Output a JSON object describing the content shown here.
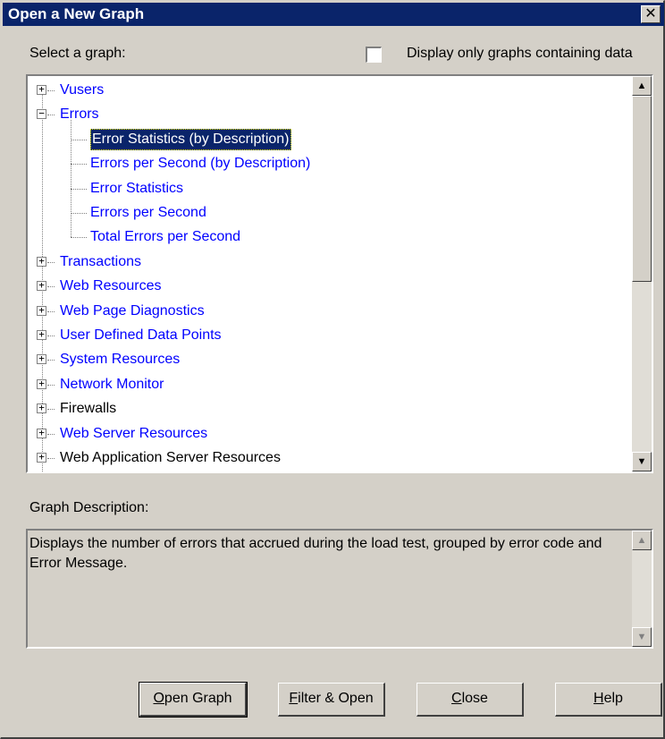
{
  "window": {
    "title": "Open a New Graph",
    "close_glyph": "✕"
  },
  "select_label": "Select a graph:",
  "filter_checkbox": {
    "label": "Display only graphs containing data",
    "checked": false
  },
  "tree": {
    "items": [
      {
        "label": "Vusers",
        "expander": "+",
        "level": 0,
        "color": "blue"
      },
      {
        "label": "Errors",
        "expander": "−",
        "level": 0,
        "color": "blue"
      },
      {
        "label": "Error Statistics (by Description)",
        "level": 1,
        "color": "blue",
        "selected": true
      },
      {
        "label": "Errors per Second (by Description)",
        "level": 1,
        "color": "blue"
      },
      {
        "label": "Error Statistics",
        "level": 1,
        "color": "blue"
      },
      {
        "label": "Errors per Second",
        "level": 1,
        "color": "blue"
      },
      {
        "label": "Total Errors per Second",
        "level": 1,
        "color": "blue"
      },
      {
        "label": "Transactions",
        "expander": "+",
        "level": 0,
        "color": "blue"
      },
      {
        "label": "Web Resources",
        "expander": "+",
        "level": 0,
        "color": "blue"
      },
      {
        "label": "Web Page Diagnostics",
        "expander": "+",
        "level": 0,
        "color": "blue"
      },
      {
        "label": "User Defined Data Points",
        "expander": "+",
        "level": 0,
        "color": "blue"
      },
      {
        "label": "System Resources",
        "expander": "+",
        "level": 0,
        "color": "blue"
      },
      {
        "label": "Network Monitor",
        "expander": "+",
        "level": 0,
        "color": "blue"
      },
      {
        "label": "Firewalls",
        "expander": "+",
        "level": 0,
        "color": "black"
      },
      {
        "label": "Web Server Resources",
        "expander": "+",
        "level": 0,
        "color": "blue"
      },
      {
        "label": "Web Application Server Resources",
        "expander": "+",
        "level": 0,
        "color": "black"
      }
    ],
    "scroll_up": "▲",
    "scroll_down": "▼"
  },
  "description": {
    "label": "Graph Description:",
    "text": "Displays the number of errors that accrued during the load test, grouped by error code and Error Message."
  },
  "buttons": {
    "open_graph": {
      "prefix": "",
      "underline": "O",
      "rest": "pen Graph"
    },
    "filter_open": {
      "prefix": "",
      "underline": "F",
      "rest": "ilter & Open"
    },
    "close": {
      "prefix": "",
      "underline": "C",
      "rest": "lose"
    },
    "help": {
      "prefix": "",
      "underline": "H",
      "rest": "elp"
    }
  },
  "colors": {
    "title_bar": "#0a246a",
    "link": "#0000ff",
    "face": "#d4d0c8"
  }
}
